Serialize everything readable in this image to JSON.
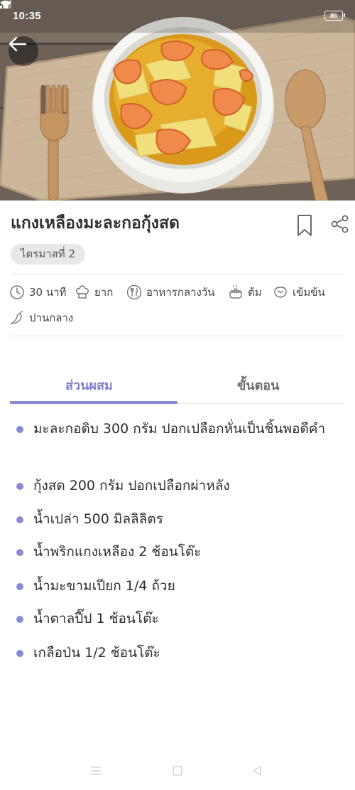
{
  "status_bar": {
    "time": "10:35",
    "battery": "86"
  },
  "recipe": {
    "title": "แกงเหลืองมะละกอกุ้งสด",
    "tag": "ไตรมาสที่ 2"
  },
  "meta": [
    {
      "icon": "clock-icon",
      "label": "30 นาที"
    },
    {
      "icon": "chef-hat-icon",
      "label": "ยาก"
    },
    {
      "icon": "utensils-icon",
      "label": "อาหารกลางวัน"
    },
    {
      "icon": "pot-icon",
      "label": "ต้ม"
    },
    {
      "icon": "flavor-icon",
      "label": "เข้มข้น"
    },
    {
      "icon": "chili-icon",
      "label": "ปานกลาง"
    }
  ],
  "tabs": [
    {
      "label": "ส่วนผสม",
      "active": true
    },
    {
      "label": "ขั้นตอน",
      "active": false
    }
  ],
  "ingredients": [
    "มะละกอดิบ 300 กรัม ปอกเปลือกหั่นเป็นชิ้นพอดีคำ",
    "กุ้งสด 200 กรัม ปอกเปลือกผ่าหลัง",
    "น้ำเปล่า 500 มิลลิลิตร",
    "น้ำพริกแกงเหลือง 2 ช้อนโต๊ะ",
    "น้ำมะขามเปียก 1/4 ถ้วย",
    "น้ำตาลปี๊ป 1 ช้อนโต๊ะ",
    "เกลือป่น 1/2 ช้อนโต๊ะ"
  ],
  "colors": {
    "accent": "#8a8bd3",
    "tab_active_text": "#7e7fcd",
    "chip_bg": "#e8e8e8"
  }
}
